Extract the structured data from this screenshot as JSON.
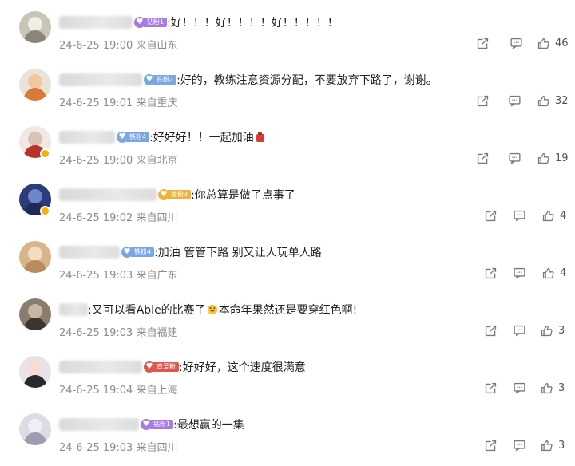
{
  "comments": [
    {
      "badge": "钻粉1",
      "badge_color": "#a77be6",
      "text": ":好！！！好！！！！好！！！！！",
      "date": "24-6-25 19:00",
      "location": "来自山东",
      "likes": "46",
      "avatar_colors": [
        "#c9c4b8",
        "#f0ede6",
        "#8b8478"
      ],
      "blur_width": 92
    },
    {
      "badge": "铁粉2",
      "badge_color": "#7aa6e6",
      "text": ":好的，教练注意资源分配，不要放弃下路了，谢谢。",
      "date": "24-6-25 19:01",
      "location": "来自重庆",
      "likes": "32",
      "avatar_colors": [
        "#e9e3da",
        "#f4c7a0",
        "#d77a3a"
      ],
      "blur_width": 104
    },
    {
      "badge": "铁粉4",
      "badge_color": "#7aa6e6",
      "text": ":好好好！！一起加油",
      "date": "24-6-25 19:00",
      "location": "来自北京",
      "likes": "19",
      "avatar_colors": [
        "#f1e7e3",
        "#d9c1b5",
        "#b5342c"
      ],
      "blur_width": 70
    },
    {
      "badge": "金粉3",
      "badge_color": "#f0b23b",
      "text": ":你总算是做了点事了",
      "date": "24-6-25 19:02",
      "location": "来自四川",
      "likes": "4",
      "avatar_colors": [
        "#2c3b7a",
        "#6d86c9",
        "#1f2a55"
      ],
      "blur_width": 122
    },
    {
      "badge": "铁粉4",
      "badge_color": "#7aa6e6",
      "text": ":加油 管管下路 别又让人玩单人路",
      "date": "24-6-25 19:03",
      "location": "来自广东",
      "likes": "4",
      "avatar_colors": [
        "#d7b48a",
        "#f3dcc0",
        "#b88a5c"
      ],
      "blur_width": 76
    },
    {
      "badge": "",
      "badge_color": "",
      "text": ":又可以看Able的比赛了",
      "text_after": "本命年果然还是要穿红色啊!",
      "date": "24-6-25 19:03",
      "location": "来自福建",
      "likes": "3",
      "avatar_colors": [
        "#8a7d6e",
        "#c7b8a4",
        "#3d3630"
      ],
      "blur_width": 36
    },
    {
      "badge": "真爱粉",
      "badge_color": "#e0554f",
      "text": ":好好好，这个速度很满意",
      "date": "24-6-25 19:04",
      "location": "来自上海",
      "likes": "3",
      "avatar_colors": [
        "#e7e3e6",
        "#f5dcd6",
        "#2a2a2e"
      ],
      "blur_width": 104
    },
    {
      "badge": "钻粉1",
      "badge_color": "#a77be6",
      "text": ":最想赢的一集",
      "date": "24-6-25 19:03",
      "location": "来自四川",
      "likes": "3",
      "avatar_colors": [
        "#dedbe6",
        "#f1eef3",
        "#9e9cae"
      ],
      "blur_width": 100
    }
  ]
}
